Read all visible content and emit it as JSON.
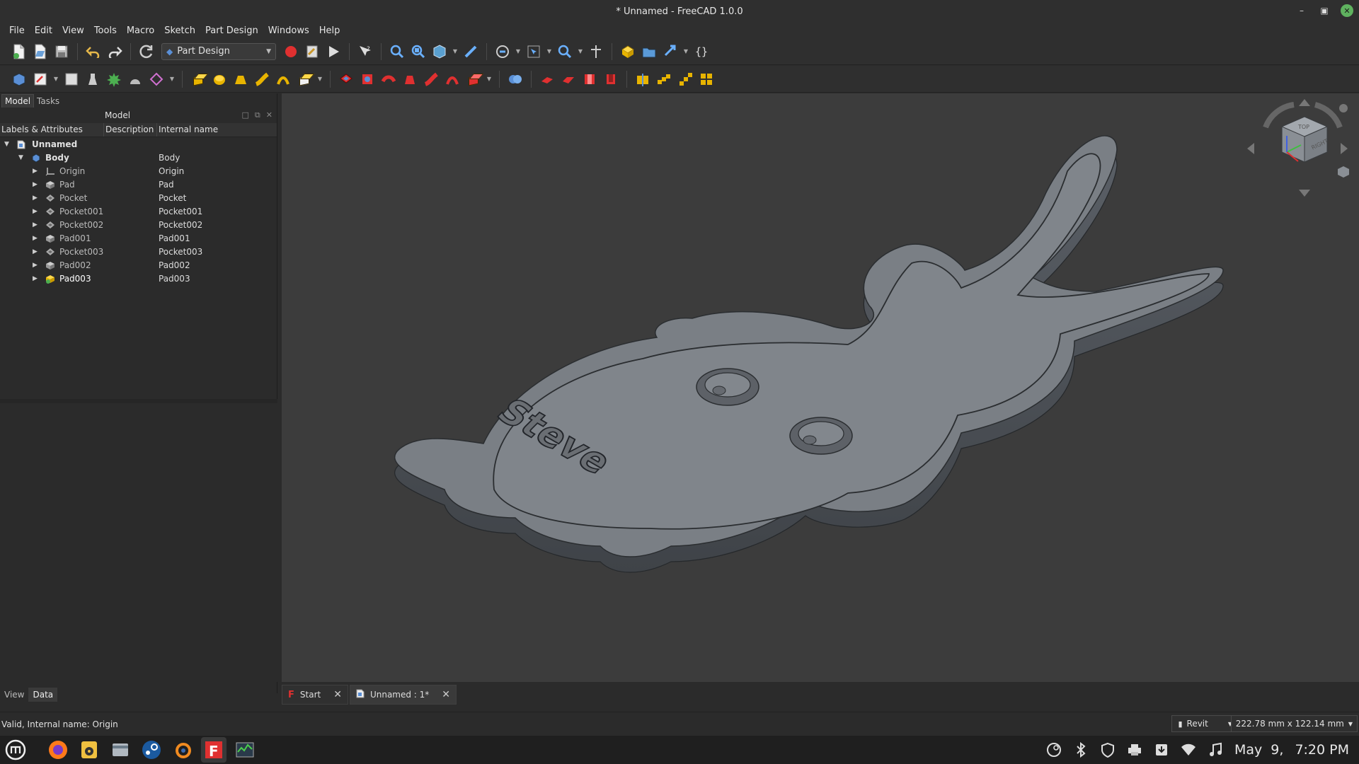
{
  "window": {
    "title": "* Unnamed - FreeCAD 1.0.0"
  },
  "menu": [
    "File",
    "Edit",
    "View",
    "Tools",
    "Macro",
    "Sketch",
    "Part Design",
    "Windows",
    "Help"
  ],
  "toolbar": {
    "workbench": "Part Design",
    "braces_label": "{}"
  },
  "left_panel": {
    "tabs": [
      "Model",
      "Tasks"
    ],
    "active_tab": "Model",
    "header": "Model",
    "columns": [
      "Labels & Attributes",
      "Description",
      "Internal name"
    ],
    "tree": [
      {
        "label": "Unnamed",
        "internal": "",
        "level": 0,
        "expanded": true,
        "icon": "document-icon",
        "bold": true
      },
      {
        "label": "Body",
        "internal": "Body",
        "level": 1,
        "expanded": true,
        "icon": "body-icon",
        "bold": true
      },
      {
        "label": "Origin",
        "internal": "Origin",
        "level": 2,
        "icon": "origin-icon"
      },
      {
        "label": "Pad",
        "internal": "Pad",
        "level": 2,
        "icon": "pad-icon"
      },
      {
        "label": "Pocket",
        "internal": "Pocket",
        "level": 2,
        "icon": "pocket-icon"
      },
      {
        "label": "Pocket001",
        "internal": "Pocket001",
        "level": 2,
        "icon": "pocket-icon"
      },
      {
        "label": "Pocket002",
        "internal": "Pocket002",
        "level": 2,
        "icon": "pocket-icon"
      },
      {
        "label": "Pad001",
        "internal": "Pad001",
        "level": 2,
        "icon": "pad-icon"
      },
      {
        "label": "Pocket003",
        "internal": "Pocket003",
        "level": 2,
        "icon": "pocket-icon"
      },
      {
        "label": "Pad002",
        "internal": "Pad002",
        "level": 2,
        "icon": "pad-icon"
      },
      {
        "label": "Pad003",
        "internal": "Pad003",
        "level": 2,
        "icon": "pad-tip-icon"
      }
    ],
    "bottom_tabs": [
      "View",
      "Data"
    ],
    "active_bottom_tab": "Data"
  },
  "viewport": {
    "engraved_text": "Steve",
    "navcube_faces": [
      "TOP",
      "RIGHT"
    ]
  },
  "document_tabs": [
    {
      "label": "Start",
      "icon": "freecad-logo-icon"
    },
    {
      "label": "Unnamed : 1*",
      "icon": "document-icon"
    }
  ],
  "status": {
    "message": "Valid, Internal name: Origin",
    "nav_style": "Revit",
    "dimensions": "222.78 mm x 122.14 mm"
  },
  "taskbar": {
    "apps": [
      "menu-icon",
      "firefox-icon",
      "rhythmbox-icon",
      "files-icon",
      "steam-icon",
      "blender-icon",
      "freecad-icon",
      "system-monitor-icon"
    ],
    "tray": [
      "steam-tray-icon",
      "bluetooth-icon",
      "shield-icon",
      "printer-icon",
      "updates-icon",
      "wifi-icon",
      "music-icon"
    ],
    "date": "May  9,",
    "time": "7:20 PM"
  }
}
